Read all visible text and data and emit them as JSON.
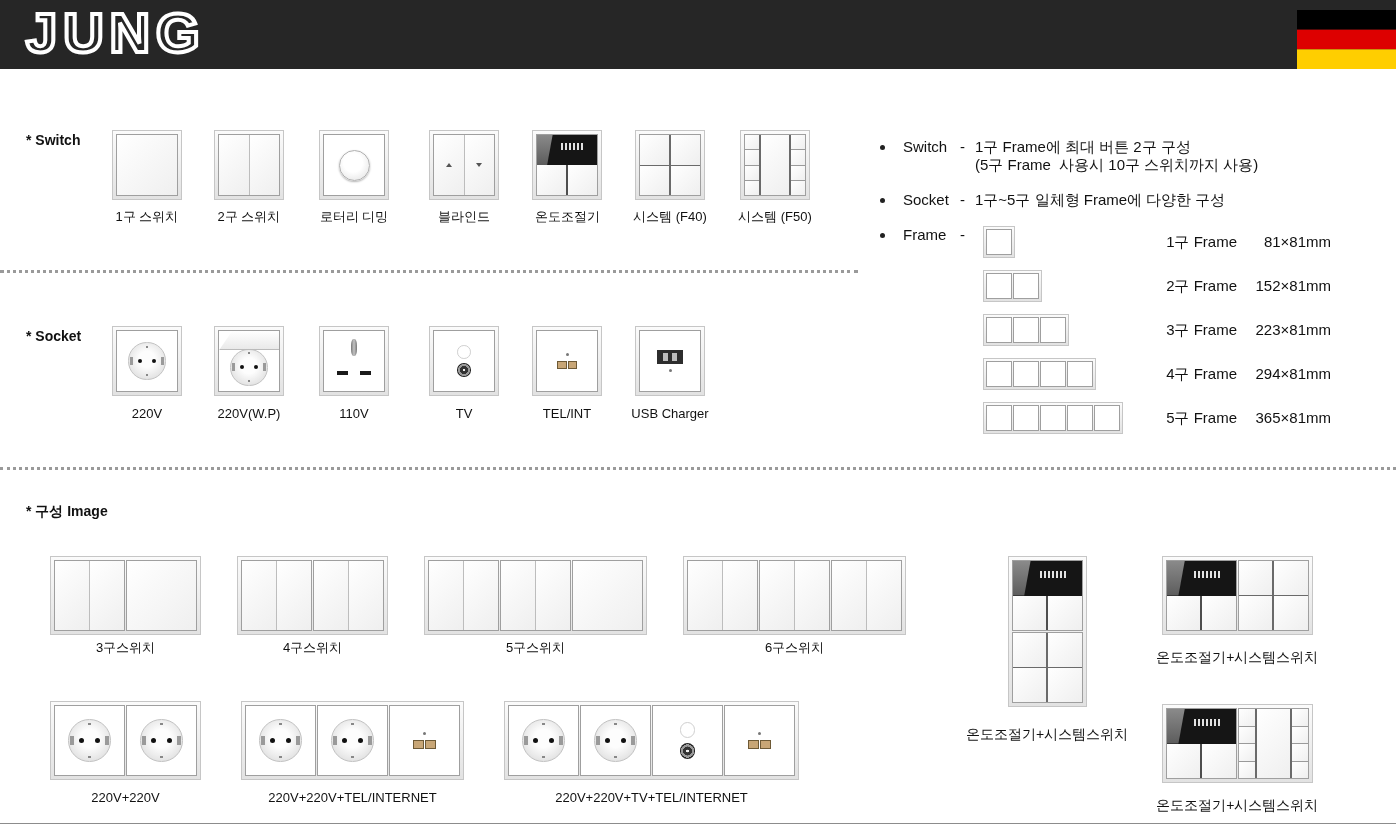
{
  "header": {
    "logo": "JUNG"
  },
  "switches": {
    "title": "* Switch",
    "items": [
      {
        "kind": "single",
        "label": "1구 스위치"
      },
      {
        "kind": "double",
        "label": "2구 스위치"
      },
      {
        "kind": "rotary",
        "label": "로터리 디밍"
      },
      {
        "kind": "blind",
        "label": "블라인드"
      },
      {
        "kind": "thermostat",
        "label": "온도조절기"
      },
      {
        "kind": "f40",
        "label": "시스템 (F40)"
      },
      {
        "kind": "f50",
        "label": "시스템 (F50)"
      }
    ]
  },
  "sockets": {
    "title": "* Socket",
    "items": [
      {
        "kind": "schuko",
        "label": "220V"
      },
      {
        "kind": "schuko_wp",
        "label": "220V(W.P)"
      },
      {
        "kind": "universal",
        "label": "110V"
      },
      {
        "kind": "tv",
        "label": "TV"
      },
      {
        "kind": "data",
        "label": "TEL/INT"
      },
      {
        "kind": "usb",
        "label": "USB Charger"
      }
    ]
  },
  "specs": [
    {
      "term": "Switch",
      "dash": "-",
      "lines": [
        "1구 Frame에 최대 버튼 2구 구성",
        "(5구 Frame  사용시 10구 스위치까지 사용)"
      ]
    },
    {
      "term": "Socket",
      "dash": "-",
      "lines": [
        "1구~5구 일체형 Frame에 다양한 구성"
      ]
    },
    {
      "term": "Frame",
      "dash": "-",
      "frames": [
        {
          "kind": "single",
          "label": "1구 Frame",
          "size": "81×81mm"
        },
        {
          "kind": "double",
          "label": "2구 Frame",
          "size": "152×81mm"
        },
        {
          "kind": "triple",
          "label": "3구 Frame",
          "size": "223×81mm"
        },
        {
          "kind": "quadruple",
          "label": "4구 Frame",
          "size": "294×81mm"
        },
        {
          "kind": "quintuple",
          "label": "5구 Frame",
          "size": "365×81mm"
        }
      ]
    }
  ],
  "composition": {
    "title": "* 구성 Image",
    "switch_sets": [
      {
        "label": "3구스위치",
        "modules": [
          {
            "kind": "double"
          },
          {
            "kind": "single"
          }
        ]
      },
      {
        "label": "4구스위치",
        "modules": [
          {
            "kind": "double"
          },
          {
            "kind": "double"
          }
        ]
      },
      {
        "label": "5구스위치",
        "modules": [
          {
            "kind": "double"
          },
          {
            "kind": "double"
          },
          {
            "kind": "single"
          }
        ]
      },
      {
        "label": "6구스위치",
        "modules": [
          {
            "kind": "double"
          },
          {
            "kind": "double"
          },
          {
            "kind": "double"
          }
        ]
      }
    ],
    "socket_sets": [
      {
        "label": "220V+220V",
        "modules": [
          {
            "kind": "schuko"
          },
          {
            "kind": "schuko"
          }
        ]
      },
      {
        "label": "220V+220V+TEL/INTERNET",
        "modules": [
          {
            "kind": "schuko"
          },
          {
            "kind": "schuko"
          },
          {
            "kind": "data"
          }
        ]
      },
      {
        "label": "220V+220V+TV+TEL/INTERNET",
        "modules": [
          {
            "kind": "schuko"
          },
          {
            "kind": "schuko"
          },
          {
            "kind": "tv"
          },
          {
            "kind": "data"
          }
        ]
      }
    ],
    "thermostat_sets": [
      {
        "label": "온도조절기+시스템스위치",
        "kind": "vertical",
        "modules": [
          {
            "kind": "thermostat"
          },
          {
            "kind": "f40"
          }
        ]
      },
      {
        "label": "온도조절기+시스템스위치",
        "kind": "horizontal",
        "modules": [
          {
            "kind": "thermostat"
          },
          {
            "kind": "f40"
          }
        ]
      },
      {
        "label": "온도조절기+시스템스위치",
        "kind": "horizontal",
        "modules": [
          {
            "kind": "thermostat"
          },
          {
            "kind": "f50"
          }
        ]
      }
    ]
  }
}
